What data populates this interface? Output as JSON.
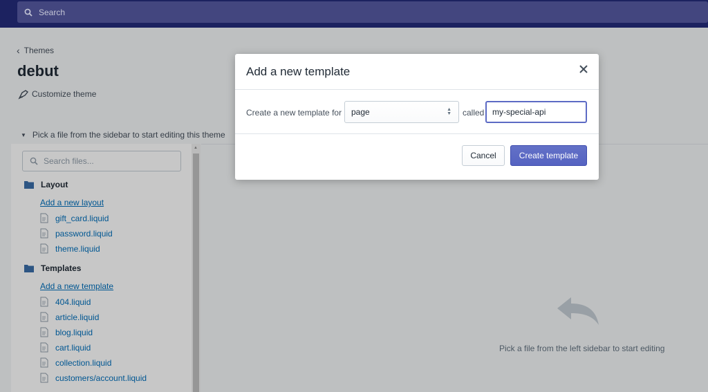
{
  "topbar": {
    "search_placeholder": "Search"
  },
  "breadcrumb": {
    "label": "Themes"
  },
  "page": {
    "title": "debut",
    "customize_label": "Customize theme"
  },
  "editor": {
    "pick_hint": "Pick a file from the sidebar to start editing this theme",
    "file_search_placeholder": "Search files...",
    "empty_state_text": "Pick a file from the left sidebar to start editing"
  },
  "sidebar": {
    "layout": {
      "label": "Layout",
      "add_link": "Add a new layout",
      "files": [
        "gift_card.liquid",
        "password.liquid",
        "theme.liquid"
      ]
    },
    "templates": {
      "label": "Templates",
      "add_link": "Add a new template",
      "files": [
        "404.liquid",
        "article.liquid",
        "blog.liquid",
        "cart.liquid",
        "collection.liquid",
        "customers/account.liquid"
      ]
    }
  },
  "modal": {
    "title": "Add a new template",
    "create_for_label": "Create a new template for",
    "type_select_value": "page",
    "called_label": "called",
    "name_input_value": "my-special-api",
    "cancel_label": "Cancel",
    "create_label": "Create template"
  },
  "colors": {
    "topbar": "#1c2260",
    "primary_button": "#5c6ac4",
    "link": "#006fbb"
  }
}
